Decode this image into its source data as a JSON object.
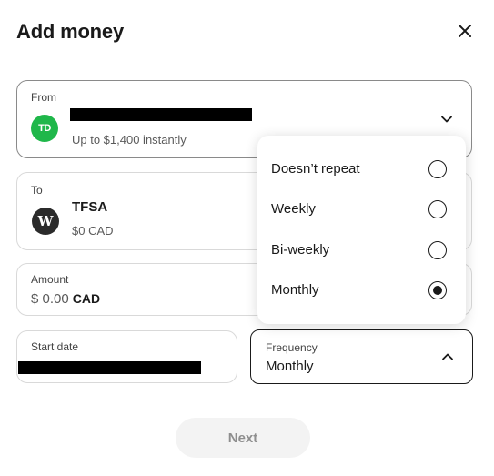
{
  "dialog": {
    "title": "Add money"
  },
  "from": {
    "label": "From",
    "bank_logo_text": "TD",
    "subtitle": "Up to $1,400 instantly"
  },
  "to": {
    "label": "To",
    "logo_text": "W",
    "account_name": "TFSA",
    "balance": "$0 CAD"
  },
  "amount": {
    "label": "Amount",
    "value": "$ 0.00",
    "currency": "CAD"
  },
  "start_date": {
    "label": "Start date"
  },
  "frequency": {
    "label": "Frequency",
    "value": "Monthly",
    "options": [
      {
        "label": "Doesn’t repeat",
        "selected": false
      },
      {
        "label": "Weekly",
        "selected": false
      },
      {
        "label": "Bi-weekly",
        "selected": false
      },
      {
        "label": "Monthly",
        "selected": true
      }
    ]
  },
  "actions": {
    "next_label": "Next"
  },
  "colors": {
    "td_green": "#1fb74a",
    "wealthsimple_dark": "#2b2b2b",
    "text": "#1a1a1a"
  },
  "icons": [
    "close-icon",
    "chevron-down-icon",
    "chevron-up-icon",
    "radio-icon"
  ]
}
